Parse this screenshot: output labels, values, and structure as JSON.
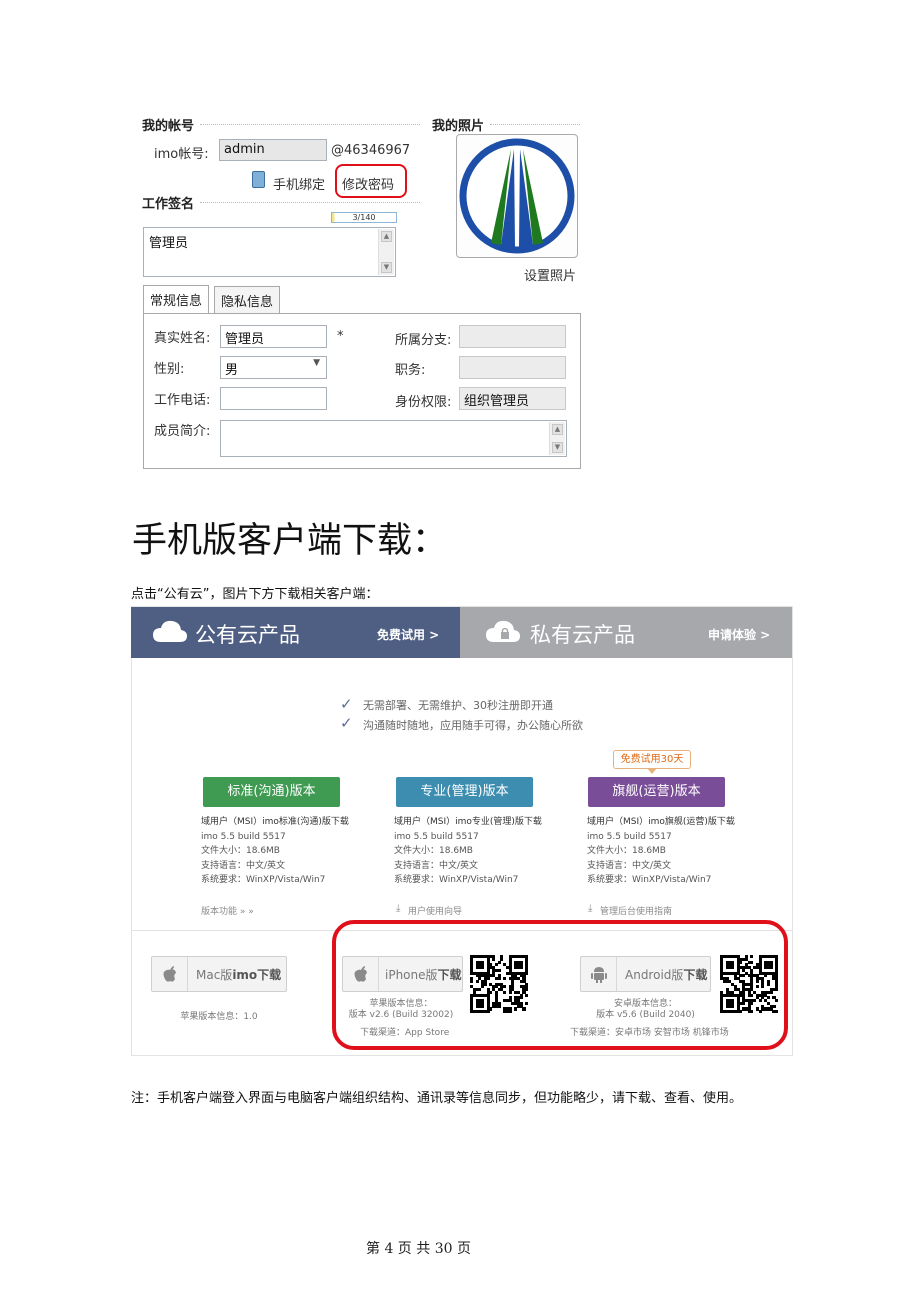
{
  "account": {
    "title": "我的帐号",
    "imo_label": "imo帐号:",
    "imo_value": "admin",
    "imo_suffix": "@46346967",
    "phone_bind": "手机绑定",
    "change_password": "修改密码"
  },
  "photo": {
    "title": "我的照片",
    "set_photo": "设置照片"
  },
  "signature": {
    "title": "工作签名",
    "counter": "3/140",
    "value": "管理员"
  },
  "tabs": [
    "常规信息",
    "隐私信息"
  ],
  "form": {
    "real_name_label": "真实姓名:",
    "real_name_value": "管理员",
    "required_mark": "*",
    "branch_label": "所属分支:",
    "branch_value": "",
    "gender_label": "性别:",
    "gender_value": "男",
    "position_label": "职务:",
    "position_value": "",
    "work_phone_label": "工作电话:",
    "work_phone_value": "",
    "role_label": "身份权限:",
    "role_value": "组织管理员",
    "intro_label": "成员简介:",
    "intro_value": ""
  },
  "heading": "手机版客户端下载：",
  "instruction": "点击“公有云”，图片下方下载相关客户端：",
  "download_page": {
    "public_title": "公有云产品",
    "public_link": "免费试用 >",
    "private_title": "私有云产品",
    "private_link": "申请体验 >",
    "features": [
      "无需部署、无需维护、30秒注册即开通",
      "沟通随时随地，应用随手可得，办公随心所欲"
    ],
    "trial_badge": "免费试用30天",
    "editions": [
      {
        "button": "标准(沟通)版本",
        "color": "#3f9a52",
        "info": [
          "域用户（MSI）imo标准(沟通)版下载",
          "imo 5.5 build 5517",
          "文件大小：18.6MB",
          "支持语言：中文/英文",
          "系统要求：WinXP/Vista/Win7"
        ],
        "link": "版本功能 » »"
      },
      {
        "button": "专业(管理)版本",
        "color": "#3c8db0",
        "info": [
          "域用户（MSI）imo专业(管理)版下载",
          "imo 5.5 build 5517",
          "文件大小：18.6MB",
          "支持语言：中文/英文",
          "系统要求：WinXP/Vista/Win7"
        ],
        "link": "用户使用向导"
      },
      {
        "button": "旗舰(运营)版本",
        "color": "#7a4d99",
        "info": [
          "域用户（MSI）imo旗舰(运营)版下载",
          "imo 5.5 build 5517",
          "文件大小：18.6MB",
          "支持语言：中文/英文",
          "系统要求：WinXP/Vista/Win7"
        ],
        "link": "管理后台使用指南"
      }
    ],
    "mac": {
      "label": "Mac版",
      "bold": "imo下载",
      "info": "苹果版本信息：1.0"
    },
    "iphone": {
      "label": "iPhone版",
      "bold": "下载",
      "info1": "苹果版本信息：",
      "info2": "版本 v2.6 (Build 32002)",
      "channel": "下载渠道：App Store"
    },
    "android": {
      "label": "Android版",
      "bold": "下载",
      "info1": "安卓版本信息：",
      "info2": "版本 v5.6 (Build 2040)",
      "channel": "下载渠道：安卓市场   安智市场   机锋市场"
    },
    "highlight_color": "#e0101a"
  },
  "note": "注：手机客户端登入界面与电脑客户端组织结构、通讯录等信息同步，但功能略少，请下载、查看、使用。",
  "footer": "第 4 页 共 30 页"
}
